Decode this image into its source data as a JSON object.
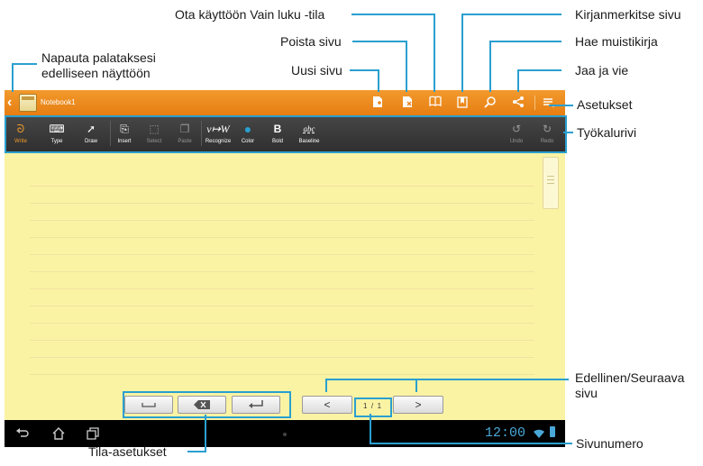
{
  "callouts": {
    "read_only": "Ota käyttöön Vain luku -tila",
    "delete_page": "Poista sivu",
    "new_page": "Uusi sivu",
    "back_line1": "Napauta palataksesi",
    "back_line2": "edelliseen näyttöön",
    "bookmark": "Kirjanmerkitse sivu",
    "search": "Hae muistikirja",
    "share": "Jaa ja vie",
    "settings": "Asetukset",
    "toolbar": "Työkalurivi",
    "prev_next_line1": "Edellinen/Seuraava",
    "prev_next_line2": "sivu",
    "page_number": "Sivunumero",
    "mode_settings": "Tila-asetukset"
  },
  "app": {
    "notebook_title": "Notebook1"
  },
  "toolbar": {
    "items": [
      {
        "label": "Write",
        "icon": "pen-icon",
        "glyph": "ᘐ"
      },
      {
        "label": "Type",
        "icon": "keyboard-icon",
        "glyph": "⌨"
      },
      {
        "label": "Draw",
        "icon": "brush-icon",
        "glyph": "➚"
      },
      {
        "label": "Insert",
        "icon": "insert-icon",
        "glyph": "⎘"
      },
      {
        "label": "Select",
        "icon": "select-icon",
        "glyph": "⬚"
      },
      {
        "label": "Paste",
        "icon": "paste-icon",
        "glyph": "❐"
      },
      {
        "label": "Recognize",
        "icon": "recognize-icon",
        "glyph": "ν↦W"
      },
      {
        "label": "Color",
        "icon": "color-icon",
        "glyph": "●"
      },
      {
        "label": "Bold",
        "icon": "bold-icon",
        "glyph": "B"
      },
      {
        "label": "Baseline",
        "icon": "baseline-icon",
        "glyph": "abc"
      },
      {
        "label": "Undo",
        "icon": "undo-icon",
        "glyph": "↺"
      },
      {
        "label": "Redo",
        "icon": "redo-icon",
        "glyph": "↻"
      }
    ]
  },
  "pager": {
    "prev": "<",
    "next": ">",
    "current": "1",
    "separator": "/",
    "total": "1"
  },
  "system": {
    "clock": "12:00"
  },
  "colors": {
    "accent": "#2a9fd0",
    "actionbar": "#ef8f22",
    "active_tool": "#f39a2a",
    "page": "#fbf3a4"
  }
}
